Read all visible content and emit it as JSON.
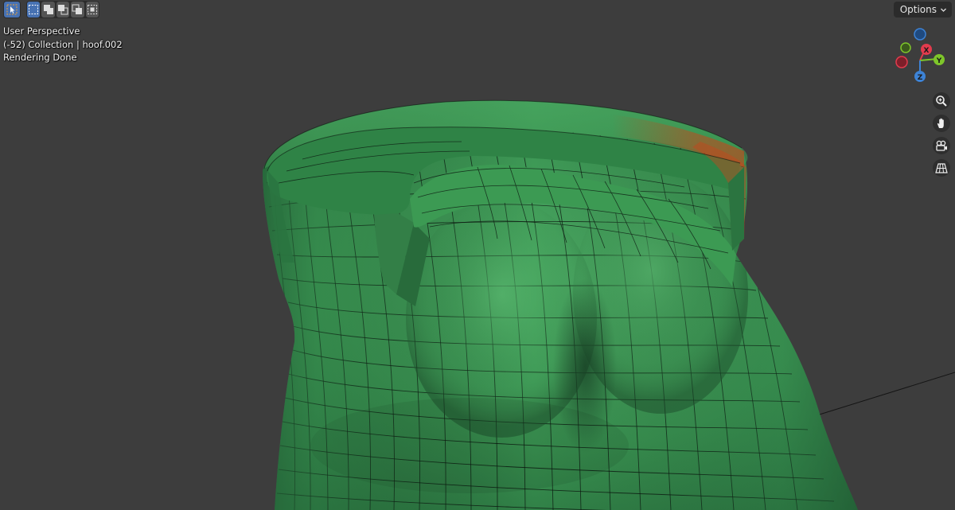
{
  "toolbar": {
    "select_tool_icon": "cursor-select-icon",
    "select_modes": [
      "select-new-icon",
      "select-extend-icon",
      "select-subtract-icon",
      "select-invert-icon",
      "select-intersect-icon"
    ]
  },
  "options_menu": {
    "label": "Options",
    "icon": "chevron-down-icon"
  },
  "overlay": {
    "view_name": "User Perspective",
    "collection_line": "(-52) Collection | hoof.002",
    "status": "Rendering Done"
  },
  "gizmo": {
    "x_label": "X",
    "y_label": "Y",
    "z_label": "Z",
    "colors": {
      "x": "#e23b4d",
      "y": "#7ec62a",
      "z": "#3d83d6"
    }
  },
  "navigation": [
    {
      "icon": "zoom-icon"
    },
    {
      "icon": "hand-pan-icon"
    },
    {
      "icon": "camera-icon"
    },
    {
      "icon": "grid-perspective-icon"
    }
  ],
  "colors": {
    "viewport_bg": "#3d3d3d",
    "mesh_green": "#3f9a55",
    "mesh_dark": "#24683a",
    "wire": "#0b160f",
    "accent_orange": "#c7451a",
    "active_tool": "#4772b3"
  }
}
